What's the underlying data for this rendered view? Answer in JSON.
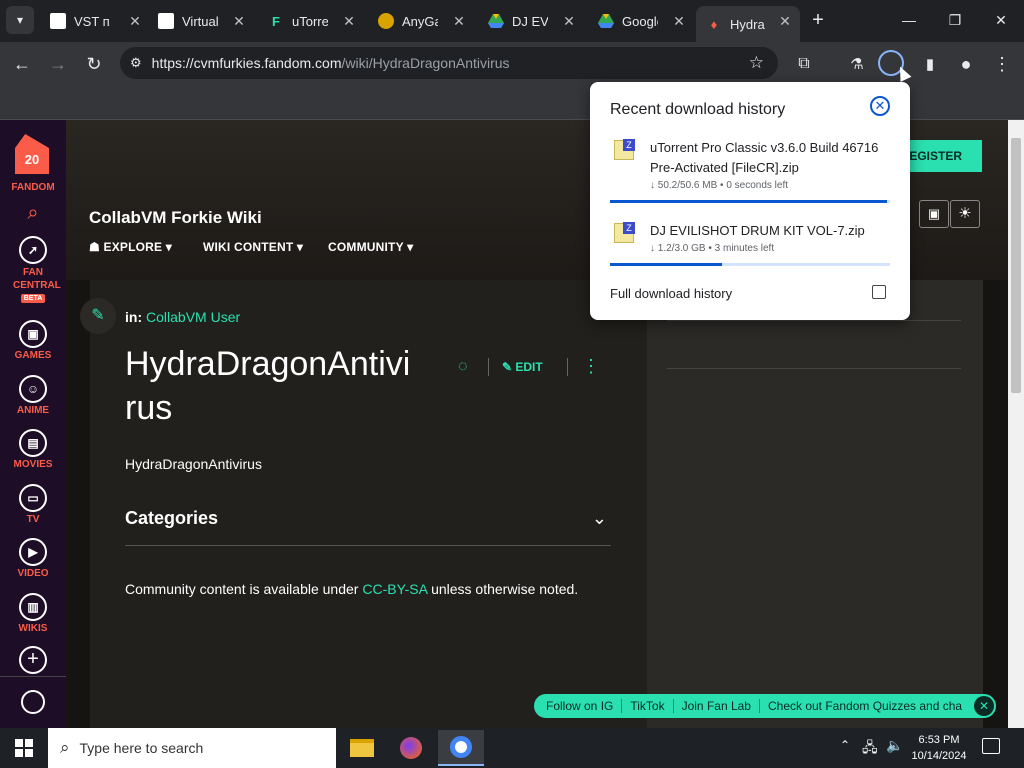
{
  "tabs": [
    {
      "title": "VST пла"
    },
    {
      "title": "Virtual"
    },
    {
      "title": "uTorre"
    },
    {
      "title": "AnyGa"
    },
    {
      "title": "DJ EVIL"
    },
    {
      "title": "Google"
    },
    {
      "title": "Hydra"
    }
  ],
  "toolbar": {
    "url_host": "https://cvmfurkies.fandom.com",
    "url_path": "/wiki/HydraDragonAntivirus"
  },
  "rail": {
    "logo_text": "20",
    "brand": "FANDOM",
    "items": [
      "FAN CENTRAL",
      "BETA",
      "GAMES",
      "ANIME",
      "MOVIES",
      "TV",
      "VIDEO",
      "WIKIS"
    ]
  },
  "wiki": {
    "name": "CollabVM Forkie Wiki",
    "nav": [
      "EXPLORE",
      "WIKI CONTENT",
      "COMMUNITY"
    ],
    "register": "REGISTER",
    "in_label": "in:",
    "category_link": "CollabVM User",
    "title_line1": "HydraDragonAntivi",
    "title_line2": "rus",
    "edit_label": "EDIT",
    "body_text": "HydraDragonAntivirus",
    "categories_label": "Categories",
    "license_pre": "Community content is available under ",
    "license_link": "CC-BY-SA",
    "license_post": " unless otherwise noted."
  },
  "downloads": {
    "header": "Recent download history",
    "items": [
      {
        "name": "uTorrent Pro Classic v3.6.0 Build 46716 Pre-Activated [FileCR].zip",
        "meta": "↓ 50.2/50.6 MB • 0 seconds left",
        "progress": 0.99
      },
      {
        "name": "DJ EVILISHOT DRUM KIT VOL-7.zip",
        "meta": "↓ 1.2/3.0 GB • 3 minutes left",
        "progress": 0.4
      }
    ],
    "full_history": "Full download history"
  },
  "followbar": [
    "Follow on IG",
    "TikTok",
    "Join Fan Lab",
    "Check out Fandom Quizzes and cha"
  ],
  "taskbar": {
    "search_placeholder": "Type here to search",
    "time": "6:53 PM",
    "date": "10/14/2024"
  },
  "colors": {
    "accent": "#2ae0b0",
    "fandom": "#fa5c49",
    "chrome_dark": "#202124",
    "download_blue": "#0b57d0"
  }
}
